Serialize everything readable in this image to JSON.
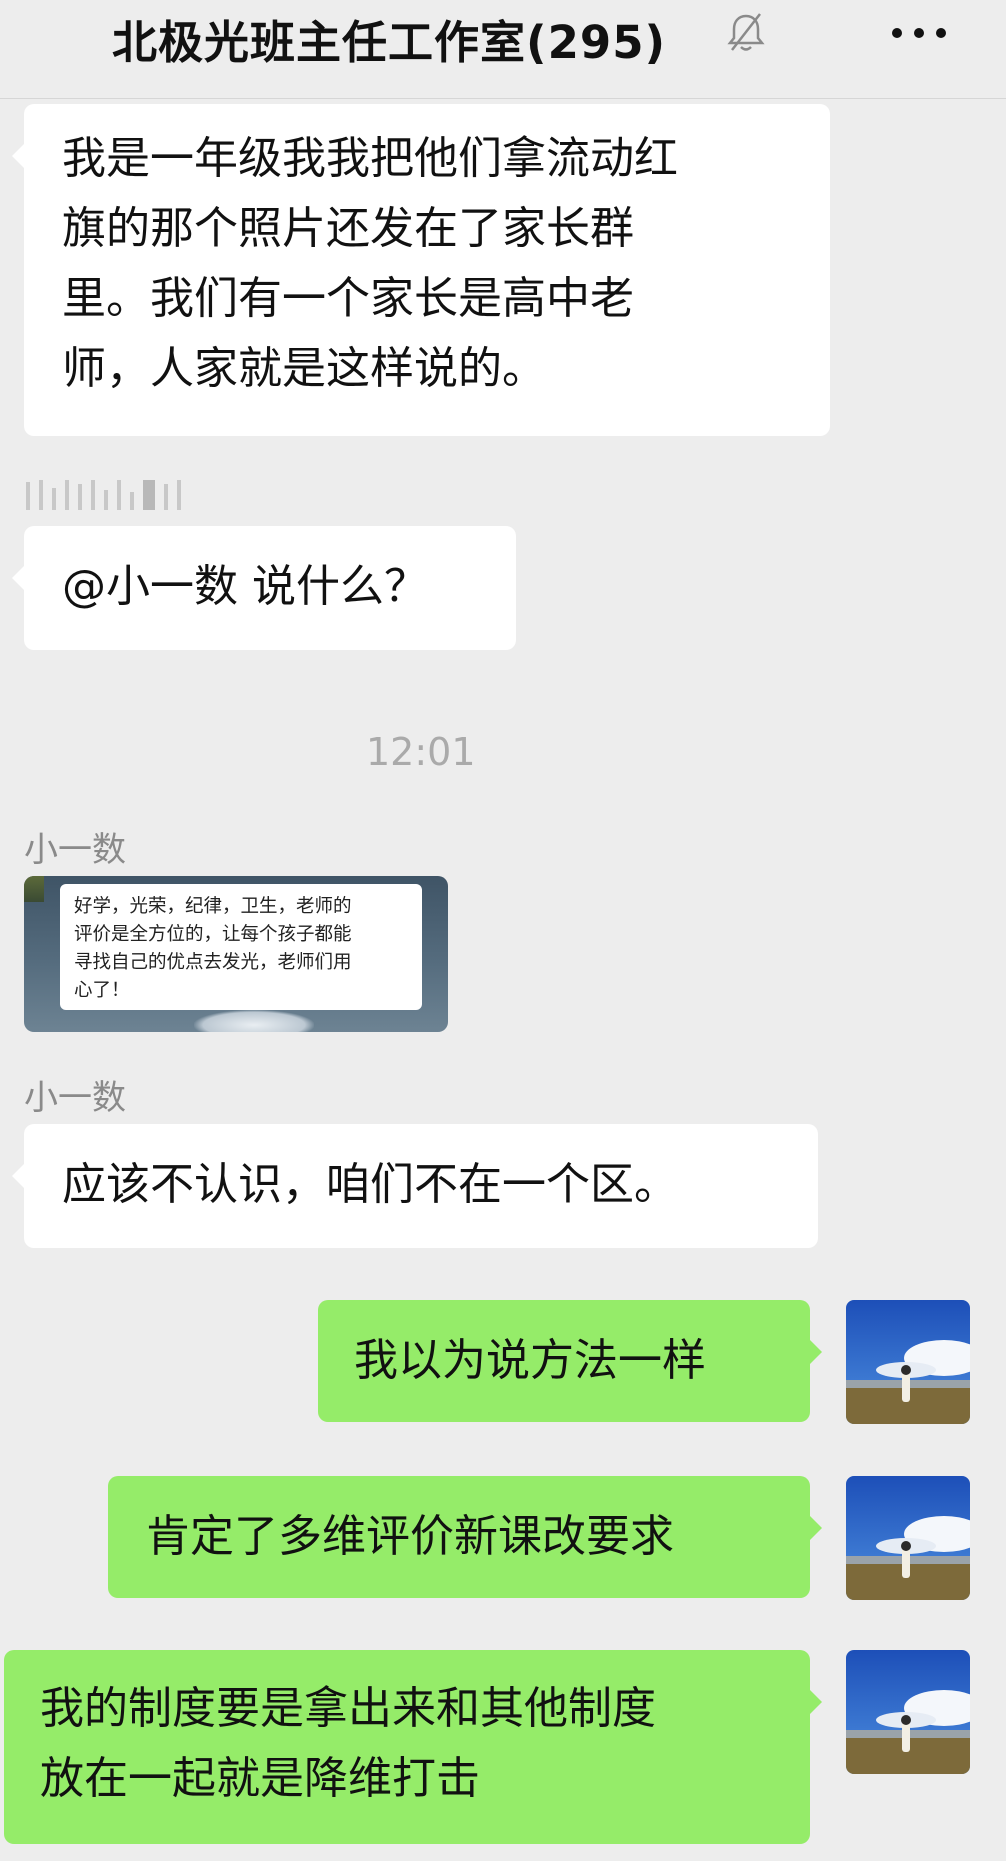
{
  "header": {
    "title": "北极光班主任工作室(295)",
    "mute_icon": "bell-slash-icon",
    "more_icon": "more-dots-icon"
  },
  "messages": {
    "m1": {
      "lines": [
        "我是一年级我我把他们拿流动红",
        "旗的那个照片还发在了家长群",
        "里。我们有一个家长是高中老",
        "师，人家就是这样说的。"
      ]
    },
    "m2": {
      "text": "@小一数 说什么？"
    },
    "timestamp": "12:01",
    "sender_a": "小一数",
    "image_note": {
      "lines": [
        "好学，光荣，纪律，卫生，老师的",
        "评价是全方位的，让每个孩子都能",
        "寻找自己的优点去发光，老师们用",
        "心了！"
      ]
    },
    "sender_b": "小一数",
    "m3": {
      "text": "应该不认识，咱们不在一个区。"
    },
    "m4": {
      "text": "我以为说方法一样"
    },
    "m5": {
      "text": "肯定了多维评价新课改要求"
    },
    "m6": {
      "lines": [
        "我的制度要是拿出来和其他制度",
        "放在一起就是降维打击"
      ]
    }
  },
  "colors": {
    "background": "#ededed",
    "incoming_bubble": "#ffffff",
    "outgoing_bubble": "#95ec69"
  }
}
